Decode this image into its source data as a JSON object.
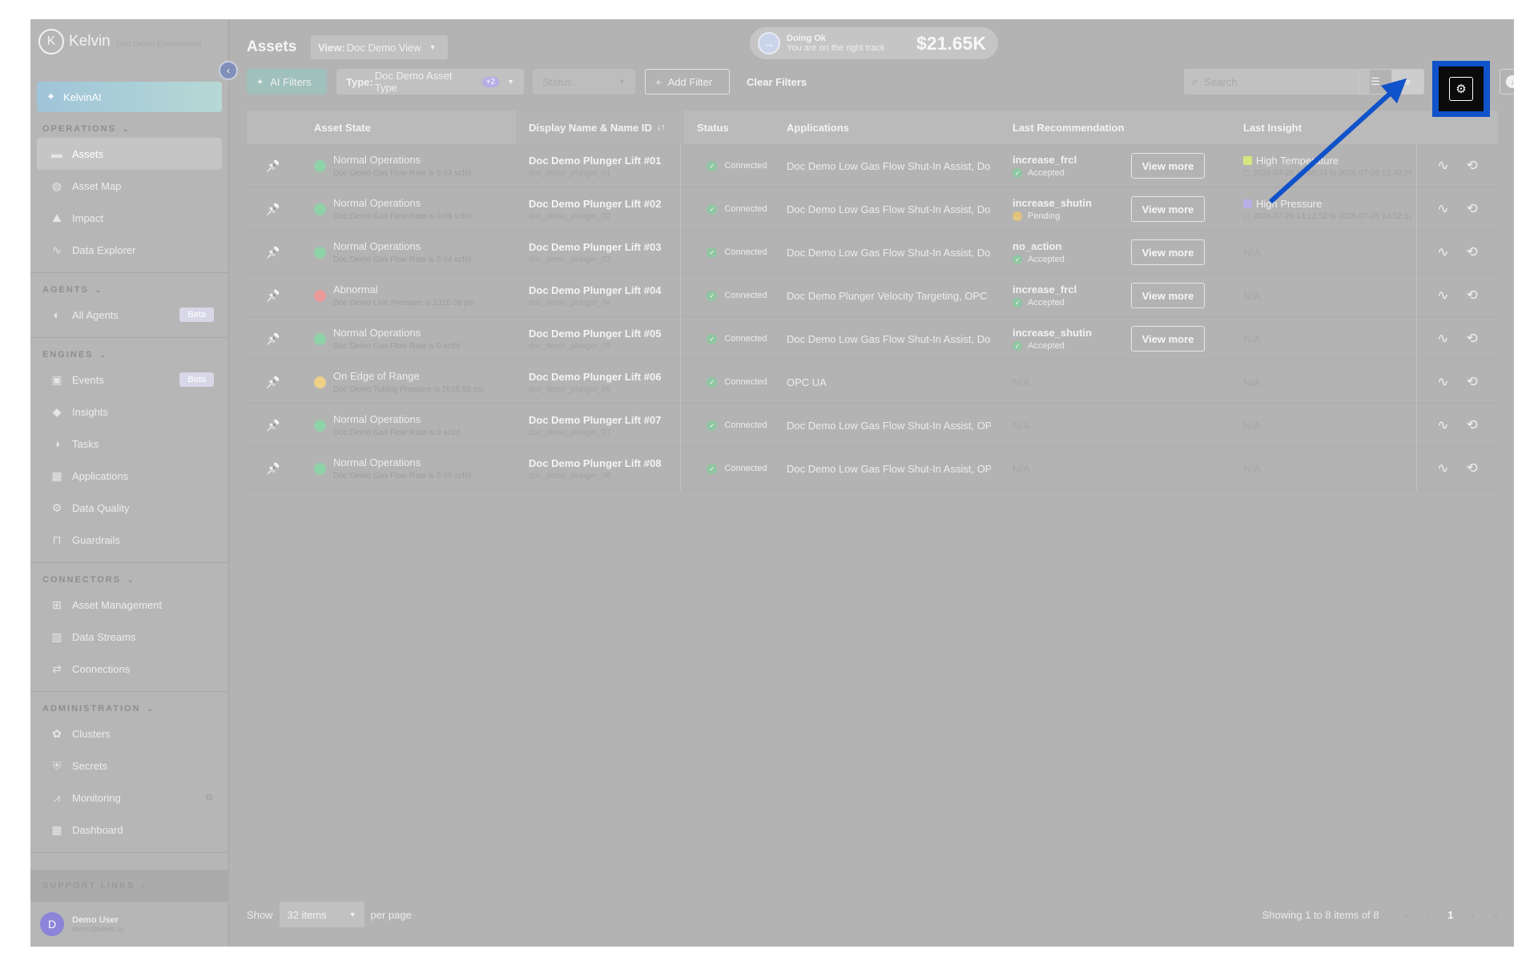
{
  "brand": {
    "logo_letter": "K",
    "name": "Kelvin",
    "subtitle": "Doc Demo Environment"
  },
  "sidebar": {
    "kelvinai_label": "KelvinAI",
    "sections": [
      {
        "title": "OPERATIONS",
        "items": [
          {
            "label": "Assets",
            "icon": "assets-icon",
            "active": true
          },
          {
            "label": "Asset Map",
            "icon": "globe-icon"
          },
          {
            "label": "Impact",
            "icon": "impact-icon"
          },
          {
            "label": "Data Explorer",
            "icon": "pulse-icon"
          }
        ]
      },
      {
        "title": "AGENTS",
        "items": [
          {
            "label": "All Agents",
            "icon": "agents-icon",
            "badge": "Beta"
          }
        ]
      },
      {
        "title": "ENGINES",
        "items": [
          {
            "label": "Events",
            "icon": "events-icon",
            "badge": "Beta"
          },
          {
            "label": "Insights",
            "icon": "insights-icon"
          },
          {
            "label": "Tasks",
            "icon": "tasks-icon"
          },
          {
            "label": "Applications",
            "icon": "applications-icon"
          },
          {
            "label": "Data Quality",
            "icon": "gear-icon"
          },
          {
            "label": "Guardrails",
            "icon": "guardrails-icon"
          }
        ]
      },
      {
        "title": "CONNECTORS",
        "items": [
          {
            "label": "Asset Management",
            "icon": "asset-management-icon"
          },
          {
            "label": "Data Streams",
            "icon": "data-streams-icon"
          },
          {
            "label": "Connections",
            "icon": "connections-icon"
          }
        ]
      },
      {
        "title": "ADMINISTRATION",
        "items": [
          {
            "label": "Clusters",
            "icon": "clusters-icon"
          },
          {
            "label": "Secrets",
            "icon": "shield-icon"
          },
          {
            "label": "Monitoring",
            "icon": "monitoring-icon",
            "external": true
          },
          {
            "label": "Dashboard",
            "icon": "dashboard-icon"
          }
        ]
      }
    ],
    "support_label": "SUPPORT LINKS",
    "user": {
      "initial": "D",
      "name": "Demo User",
      "email": "demo@kelvin.ai"
    }
  },
  "header": {
    "title": "Assets",
    "view_prefix": "View:",
    "view_value": "Doc Demo View",
    "status": {
      "title": "Doing Ok",
      "subtitle": "You are on the right track",
      "value": "$21.65K"
    }
  },
  "filters": {
    "ai_filters": "AI Filters",
    "type_prefix": "Type:",
    "type_value": "Doc Demo Asset Type",
    "type_extra": "+2",
    "status_placeholder": "Status",
    "add_filter": "Add Filter",
    "clear_filters": "Clear Filters",
    "search_placeholder": "Search"
  },
  "table": {
    "columns": {
      "asset_state": "Asset State",
      "display_name": "Display Name & Name ID",
      "status": "Status",
      "applications": "Applications",
      "last_recommendation": "Last Recommendation",
      "last_insight": "Last Insight"
    },
    "view_more_label": "View more",
    "na": "N/A",
    "rows": [
      {
        "state": "Normal Operations",
        "state_color": "#8fd2a8",
        "state_detail": "Doc Demo Gas Flow Rate is 0.04 scf/d",
        "name": "Doc Demo Plunger Lift #01",
        "name_id": "doc_demo_plunger_01",
        "status": "Connected",
        "applications": "Doc Demo Low Gas Flow Shut-In Assist, Doc Demo Plunger Velocity Targeting",
        "reco": "increase_frcl",
        "reco_status": "Accepted",
        "insight": "High Temperature",
        "insight_color": "#d9e67f",
        "insight_time": "2026-07-26 12:40:24 to 2026-07-26 13:40:24"
      },
      {
        "state": "Normal Operations",
        "state_color": "#8fd2a8",
        "state_detail": "Doc Demo Gas Flow Rate is 0.09 scf/d",
        "name": "Doc Demo Plunger Lift #02",
        "name_id": "doc_demo_plunger_02",
        "status": "Connected",
        "applications": "Doc Demo Low Gas Flow Shut-In Assist, Doc Demo Plunger Velocity Targeting",
        "reco": "increase_shutin",
        "reco_status": "Pending",
        "insight": "High Pressure",
        "insight_color": "#b9aee6",
        "insight_time": "2026-07-26 14:12:52 to 2026-07-26 14:52:12"
      },
      {
        "state": "Normal Operations",
        "state_color": "#8fd2a8",
        "state_detail": "Doc Demo Gas Flow Rate is 0.04 scf/d",
        "name": "Doc Demo Plunger Lift #03",
        "name_id": "doc_demo_plunger_03",
        "status": "Connected",
        "applications": "Doc Demo Low Gas Flow Shut-In Assist, Doc Demo Plunger Velocity Targeting",
        "reco": "no_action",
        "reco_status": "Accepted",
        "insight": "",
        "insight_color": "",
        "insight_time": ""
      },
      {
        "state": "Abnormal",
        "state_color": "#ec9a9a",
        "state_detail": "Doc Demo Line Pressure is 1310.38 psi",
        "name": "Doc Demo Plunger Lift #04",
        "name_id": "doc_demo_plunger_04",
        "status": "Connected",
        "applications": "Doc Demo Plunger Velocity Targeting, OPC UA",
        "reco": "increase_frcl",
        "reco_status": "Accepted",
        "insight": "",
        "insight_color": "",
        "insight_time": ""
      },
      {
        "state": "Normal Operations",
        "state_color": "#8fd2a8",
        "state_detail": "Doc Demo Gas Flow Rate is 0 scf/d",
        "name": "Doc Demo Plunger Lift #05",
        "name_id": "doc_demo_plunger_05",
        "status": "Connected",
        "applications": "Doc Demo Low Gas Flow Shut-In Assist, Doc Demo Plunger Velocity Targeting",
        "reco": "increase_shutin",
        "reco_status": "Accepted",
        "insight": "",
        "insight_color": "",
        "insight_time": ""
      },
      {
        "state": "On Edge of Range",
        "state_color": "#efd089",
        "state_detail": "Doc Demo Tubing Pressure is 2616.53 psi",
        "name": "Doc Demo Plunger Lift #06",
        "name_id": "doc_demo_plunger_06",
        "status": "Connected",
        "applications": "OPC UA",
        "reco": "",
        "reco_status": "",
        "insight": "",
        "insight_color": "",
        "insight_time": ""
      },
      {
        "state": "Normal Operations",
        "state_color": "#8fd2a8",
        "state_detail": "Doc Demo Gas Flow Rate is 0 scf/d",
        "name": "Doc Demo Plunger Lift #07",
        "name_id": "doc_demo_plunger_07",
        "status": "Connected",
        "applications": "Doc Demo Low Gas Flow Shut-In Assist, OPC UA",
        "reco": "",
        "reco_status": "",
        "insight": "",
        "insight_color": "",
        "insight_time": ""
      },
      {
        "state": "Normal Operations",
        "state_color": "#8fd2a8",
        "state_detail": "Doc Demo Gas Flow Rate is 0.05 scf/d",
        "name": "Doc Demo Plunger Lift #08",
        "name_id": "doc_demo_plunger_08",
        "status": "Connected",
        "applications": "Doc Demo Low Gas Flow Shut-In Assist, OPC UA",
        "reco": "",
        "reco_status": "",
        "insight": "",
        "insight_color": "",
        "insight_time": ""
      }
    ]
  },
  "pagination": {
    "show_label": "Show",
    "per_page_value": "32 items",
    "per_page_label": "per page",
    "info": "Showing 1 to 8 items of 8",
    "current_page": "1"
  },
  "colors": {
    "highlight": "#1052c9",
    "accent_purple": "#8c84d8"
  }
}
